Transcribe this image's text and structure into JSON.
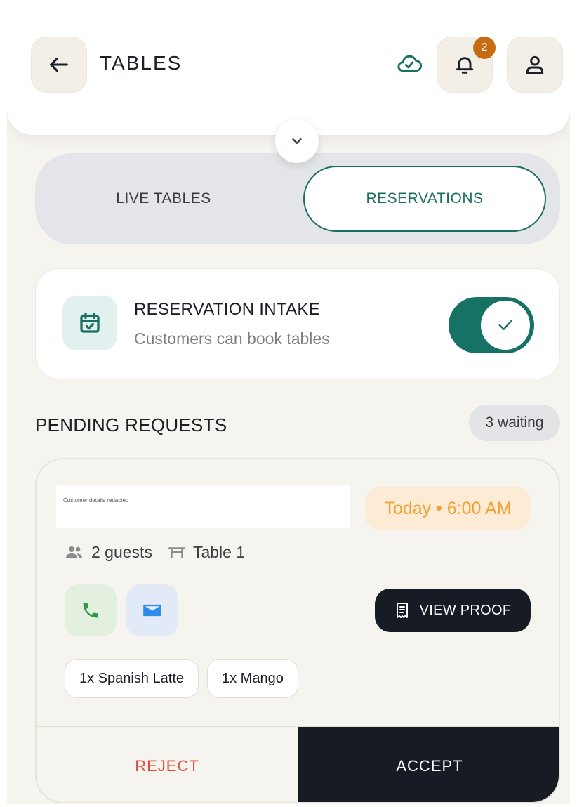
{
  "header": {
    "title": "TABLES",
    "notification_count": "2"
  },
  "tabs": [
    {
      "label": "LIVE TABLES",
      "active": false
    },
    {
      "label": "RESERVATIONS",
      "active": true
    }
  ],
  "intake": {
    "title": "RESERVATION INTAKE",
    "subtitle": "Customers can book tables",
    "enabled": true
  },
  "pending": {
    "title": "PENDING REQUESTS",
    "waiting_label": "3 waiting"
  },
  "request": {
    "customer_placeholder": "Customer details redacted",
    "time": "Today • 6:00 AM",
    "guests": "2 guests",
    "table": "Table 1",
    "proof_label": "VIEW PROOF",
    "items": [
      "1x Spanish Latte",
      "1x Mango"
    ],
    "reject_label": "REJECT",
    "accept_label": "ACCEPT"
  },
  "colors": {
    "accent": "#1a6f62",
    "background": "#f6f4ef",
    "badge": "#c66b12",
    "time_text": "#f0a133",
    "reject": "#e34b3a",
    "dark": "#161b24"
  }
}
